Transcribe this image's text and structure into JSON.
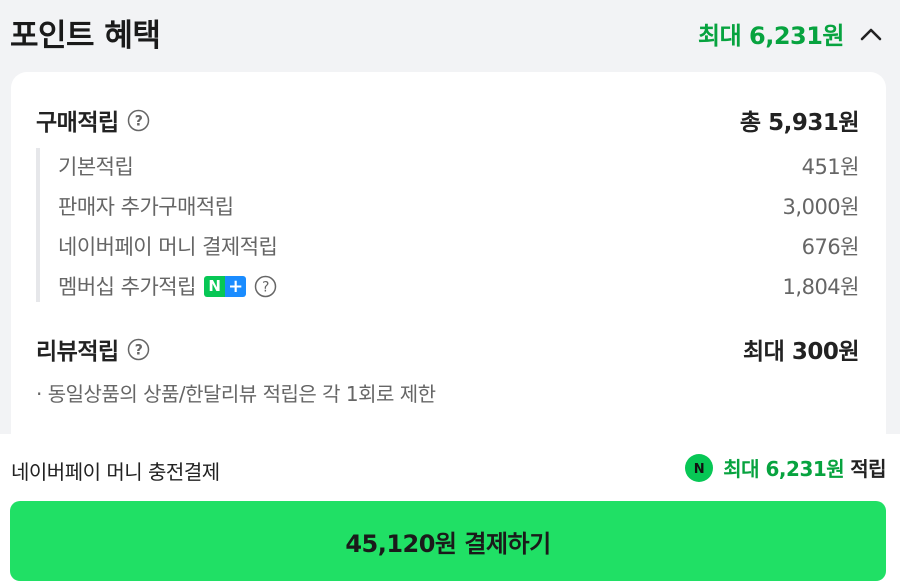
{
  "header": {
    "title": "포인트 혜택",
    "max_benefit": "최대 6,231원"
  },
  "purchase": {
    "label": "구매적립",
    "total": "총 5,931원",
    "items": [
      {
        "label": "기본적립",
        "value": "451원"
      },
      {
        "label": "판매자 추가구매적립",
        "value": "3,000원"
      },
      {
        "label": "네이버페이 머니 결제적립",
        "value": "676원"
      },
      {
        "label": "멤버십 추가적립",
        "value": "1,804원",
        "badge": "N+"
      }
    ]
  },
  "review": {
    "label": "리뷰적립",
    "value": "최대 300원",
    "note": "· 동일상품의 상품/한달리뷰 적립은 각 1회로 제한"
  },
  "footer": {
    "payment_label": "네이버페이 머니 충전결제",
    "max_points": "최대 6,231원",
    "points_suffix": "적립",
    "pay_button": "45,120원 결제하기"
  },
  "colors": {
    "accent_green": "#07a33f",
    "button_green": "#20e065",
    "npay_green": "#07c755",
    "nplus_blue": "#1a8cff"
  },
  "icons": [
    "help-icon",
    "chevron-up-icon",
    "npay-icon",
    "nplus-badge"
  ]
}
